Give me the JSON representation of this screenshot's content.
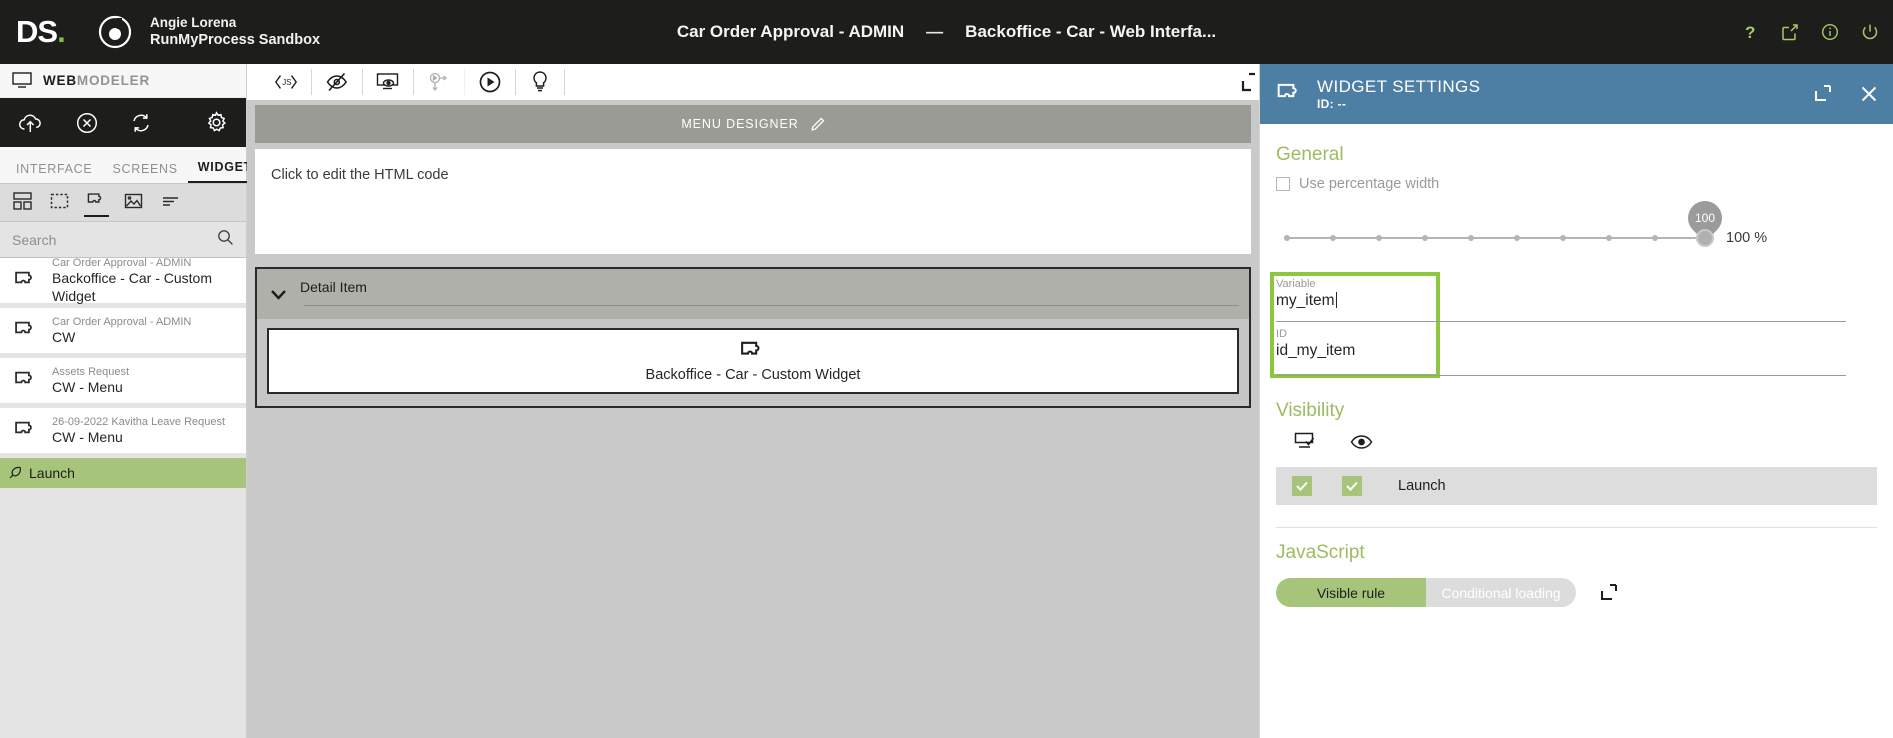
{
  "topbar": {
    "logo_text": "DS",
    "logo_dot": ".",
    "org_icon": "ring-target-icon",
    "user_name": "Angie Lorena",
    "workspace": "RunMyProcess Sandbox",
    "doc_title": "Car Order Approval - ADMIN",
    "separator": "—",
    "doc_subtitle": "Backoffice - Car - Web Interfa...",
    "actions": [
      {
        "name": "help-icon",
        "glyph": "?"
      },
      {
        "name": "external-link-icon",
        "glyph": "↗"
      },
      {
        "name": "info-icon",
        "glyph": "i"
      },
      {
        "name": "power-icon",
        "glyph": "⏻"
      }
    ],
    "accent_green": "#a8c96a"
  },
  "left_panel": {
    "app_name_bold": "WEB",
    "app_name_light": "MODELER",
    "monitor_icon": "monitor-icon",
    "tools": [
      {
        "name": "publish-cloud-icon"
      },
      {
        "name": "cancel-circle-icon"
      },
      {
        "name": "refresh-icon"
      },
      {
        "name": "gear-icon"
      }
    ],
    "tabs": [
      {
        "label": "INTERFACE",
        "active": false
      },
      {
        "label": "SCREENS",
        "active": false
      },
      {
        "label": "WIDGETS",
        "active": true
      }
    ],
    "type_icons": [
      {
        "name": "layout-grid-icon",
        "active": false
      },
      {
        "name": "dashed-container-icon",
        "active": false
      },
      {
        "name": "puzzle-widget-icon",
        "active": true
      },
      {
        "name": "image-icon",
        "active": false
      },
      {
        "name": "list-lines-icon",
        "active": false
      }
    ],
    "search": {
      "placeholder": "Search",
      "value": "",
      "icon": "search-icon"
    },
    "widgets": [
      {
        "project": "Car Order Approval - ADMIN",
        "name": "Backoffice - Car - Custom Widget",
        "icon": "puzzle-widget-icon"
      },
      {
        "project": "Car Order Approval - ADMIN",
        "name": "CW",
        "icon": "puzzle-widget-icon"
      },
      {
        "project": "Assets Request",
        "name": "CW - Menu",
        "icon": "puzzle-widget-icon"
      },
      {
        "project": "26-09-2022 Kavitha Leave Request",
        "name": "CW - Menu",
        "icon": "puzzle-widget-icon"
      }
    ],
    "launch": {
      "label": "Launch",
      "icon": "rocket-icon",
      "color": "#a7c57a"
    }
  },
  "center": {
    "toolbar": [
      {
        "name": "js-code-icon",
        "enabled": true
      },
      {
        "name": "hidden-eye-slash-icon",
        "enabled": true
      },
      {
        "name": "screen-preview-icon",
        "enabled": true
      },
      {
        "name": "process-flow-icon",
        "enabled": false
      },
      {
        "name": "run-play-icon",
        "enabled": true
      },
      {
        "name": "lightbulb-hint-icon",
        "enabled": true
      }
    ],
    "expand_icon": "expand-corner-icon",
    "menu_designer": {
      "label": "MENU DESIGNER",
      "edit_icon": "pencil-icon"
    },
    "html_placeholder": "Click to edit the HTML code",
    "detail_item": {
      "label": "Detail Item",
      "chevron": "chevron-down-icon"
    },
    "custom_widget": {
      "label": "Backoffice - Car - Custom Widget",
      "icon": "puzzle-widget-icon"
    }
  },
  "right_panel": {
    "header": {
      "icon": "puzzle-widget-icon",
      "title": "WIDGET SETTINGS",
      "id_label": "ID: --",
      "expand_icon": "expand-corner-icon",
      "close_icon": "close-icon",
      "bg_color": "#4d7ea4"
    },
    "general": {
      "heading": "General",
      "checkbox_label": "Use percentage width",
      "checkbox_checked": false,
      "slider_tooltip": "100",
      "slider_value_label": "100 %",
      "slider_value": 100,
      "slider_ticks": 10
    },
    "fields": {
      "variable_label": "Variable",
      "variable_value": "my_item",
      "id_label": "ID",
      "id_value": "id_my_item",
      "highlight_color": "#8dc63f"
    },
    "visibility": {
      "heading": "Visibility",
      "col_icons": [
        {
          "name": "screen-check-icon"
        },
        {
          "name": "eye-icon"
        }
      ],
      "rows": [
        {
          "label": "Launch",
          "screen_checked": true,
          "eye_checked": true
        }
      ]
    },
    "javascript": {
      "heading": "JavaScript",
      "segments": [
        {
          "label": "Visible rule",
          "active": true
        },
        {
          "label": "Conditional loading",
          "active": false
        }
      ],
      "expand_icon": "expand-corner-icon",
      "active_color": "#a7c57a"
    }
  }
}
